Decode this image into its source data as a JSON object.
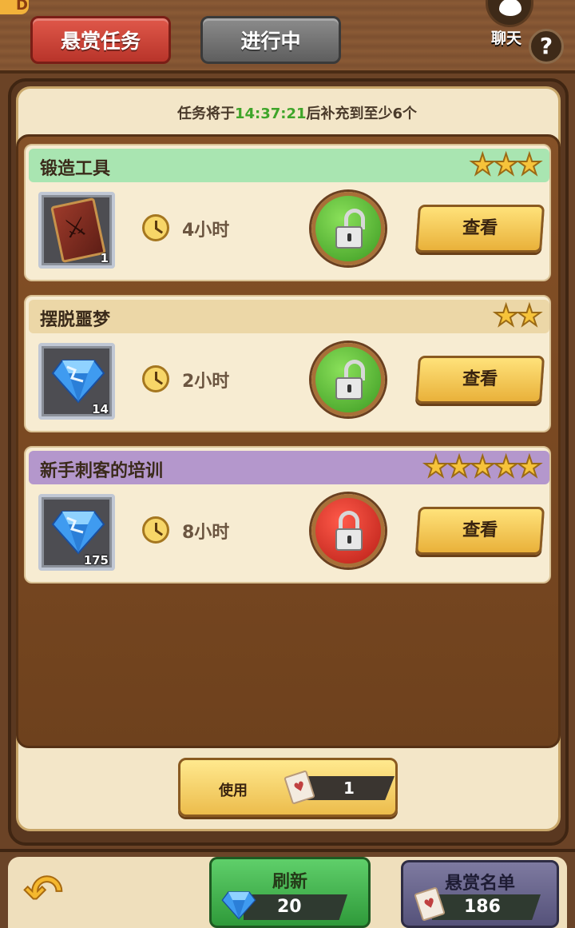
{
  "header": {
    "corner_logo": "D",
    "tabs": [
      {
        "label": "悬赏任务",
        "active": true
      },
      {
        "label": "进行中",
        "active": false
      }
    ],
    "chat_label": "聊天",
    "help_symbol": "?"
  },
  "timer": {
    "prefix": "任务将于",
    "time": "14:37:21",
    "suffix": "后补充到至少6个"
  },
  "quests": [
    {
      "title": "锻造工具",
      "stars": 3,
      "stars_text": "★★★",
      "title_color": "#a9e5b1",
      "reward_icon": "book-icon",
      "reward_count": "1",
      "duration": "4小时",
      "locked": false,
      "view_label": "查看"
    },
    {
      "title": "摆脱噩梦",
      "stars": 2,
      "stars_text": "★★",
      "title_color": "#ecd7a7",
      "reward_icon": "gem-icon",
      "reward_count": "14",
      "duration": "2小时",
      "locked": false,
      "view_label": "查看"
    },
    {
      "title": "新手刺客的培训",
      "stars": 5,
      "stars_text": "★★★★★",
      "title_color": "#b497cc",
      "reward_icon": "gem-icon",
      "reward_count": "175",
      "duration": "8小时",
      "locked": true,
      "view_label": "查看"
    }
  ],
  "use_ticket": {
    "label": "使用",
    "count": "1",
    "icon": "ticket-icon"
  },
  "bottom": {
    "back_icon": "back-arrow-icon",
    "refresh": {
      "label": "刷新",
      "cost": "20",
      "icon": "gem-icon"
    },
    "bounty_list": {
      "label": "悬赏名单",
      "count": "186",
      "icon": "ticket-icon"
    }
  },
  "colors": {
    "timer_time": "#3fa52a",
    "lock_open": "#3c9a22",
    "lock_closed": "#b81e16"
  }
}
